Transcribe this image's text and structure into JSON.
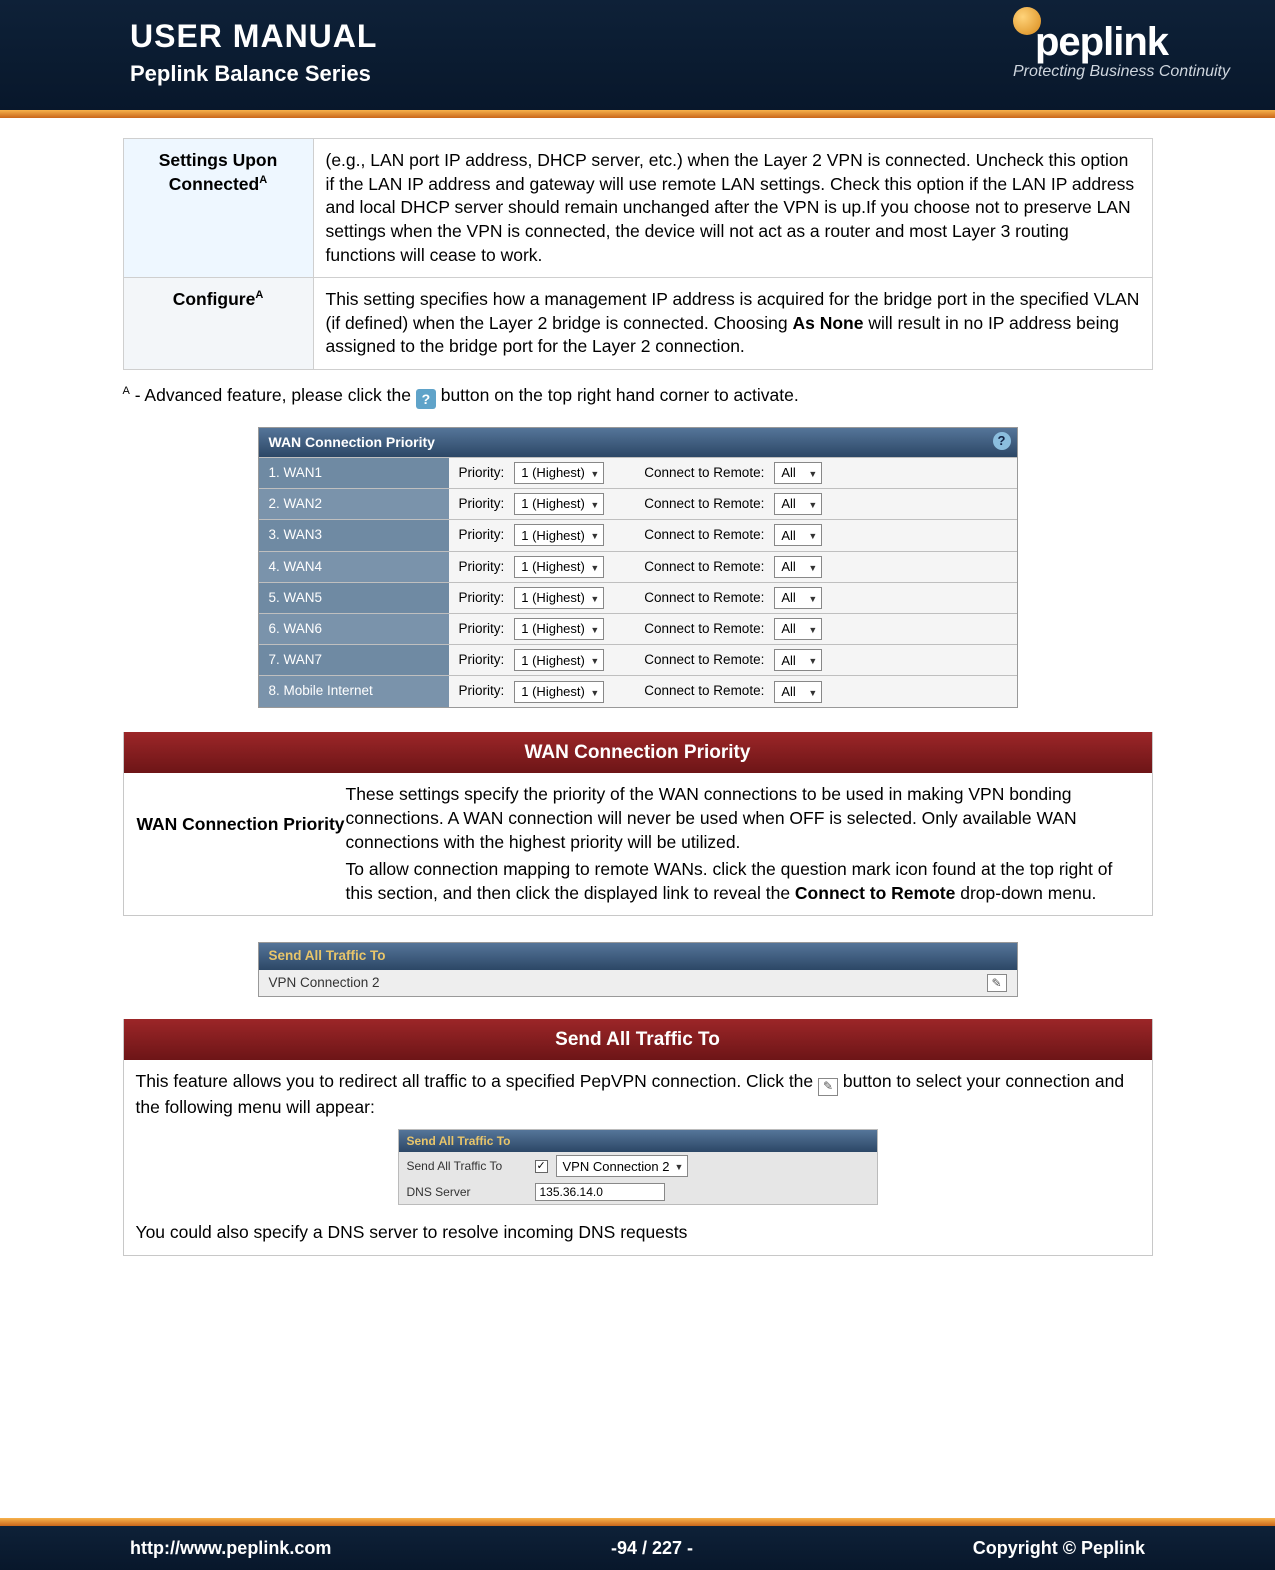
{
  "header": {
    "title": "USER MANUAL",
    "subtitle": "Peplink Balance Series",
    "brand": "peplink",
    "tagline": "Protecting Business Continuity"
  },
  "def_rows": [
    {
      "label": "Settings Upon Connected",
      "sup": "A",
      "desc": "(e.g., LAN port IP address, DHCP server, etc.) when the Layer 2 VPN is connected. Uncheck this option if the LAN IP address and gateway will use remote LAN settings. Check this option if the LAN IP address and local DHCP server should remain unchanged after the VPN is up.If you choose not to preserve LAN settings when the VPN is connected, the device will not act as a router and most Layer 3 routing functions will cease to work."
    },
    {
      "label": "Configure",
      "sup": "A",
      "desc_pre": "This setting specifies how a management IP address is acquired for the bridge port in the specified VLAN (if defined) when the Layer 2 bridge is connected. Choosing ",
      "desc_bold": "As None",
      "desc_post": " will result in no IP address being assigned to the bridge port for the Layer 2 connection."
    }
  ],
  "footnote": {
    "sup": "A",
    "pre": " - Advanced feature, please click the ",
    "post": " button on the top right hand corner to activate."
  },
  "wan_shot": {
    "title": "WAN Connection Priority",
    "priority_label": "Priority:",
    "priority_value": "1 (Highest)",
    "connect_label": "Connect to Remote:",
    "connect_value": "All",
    "rows": [
      "1. WAN1",
      "2. WAN2",
      "3. WAN3",
      "4. WAN4",
      "5. WAN5",
      "6. WAN6",
      "7. WAN7",
      "8. Mobile Internet"
    ]
  },
  "wan_section": {
    "bar": "WAN Connection Priority",
    "label": "WAN Connection Priority",
    "p1": "These settings specify the priority of the WAN connections to be used in making VPN bonding connections. A WAN connection will never be used when OFF is selected. Only available WAN connections with the highest priority will be utilized.",
    "p2_pre": "To allow connection mapping to remote WANs. click the question mark icon found at the top right of this section, and then click the displayed link to reveal the ",
    "p2_bold": "Connect to Remote",
    "p2_post": " drop-down menu."
  },
  "sat_shot1": {
    "title": "Send All Traffic To",
    "value": "VPN Connection 2"
  },
  "sat_section": {
    "bar": "Send All Traffic To",
    "p1_pre": "This feature allows you to redirect all traffic to a specified PepVPN connection. Click the ",
    "p1_post": " button to select your connection and the following menu will appear:",
    "p2": "You could also specify a DNS server to resolve incoming DNS requests"
  },
  "sat_shot2": {
    "title": "Send All Traffic To",
    "row1_label": "Send All Traffic To",
    "row1_value": "VPN Connection 2",
    "row2_label": "DNS Server",
    "row2_value": "135.36.14.0"
  },
  "footer": {
    "left": "http://www.peplink.com",
    "center": "-94 / 227 -",
    "right": "Copyright ©  Peplink"
  }
}
